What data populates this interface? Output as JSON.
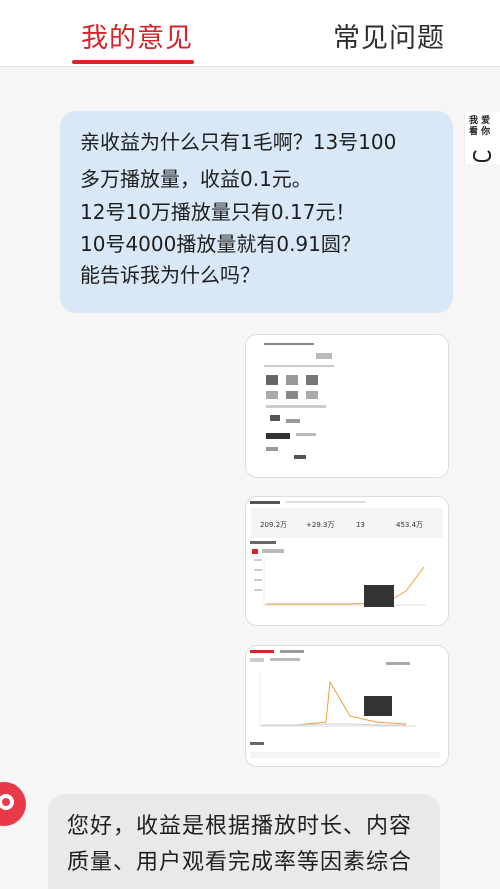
{
  "tabs": {
    "mine": "我的意见",
    "faq": "常见问题"
  },
  "user_avatar": {
    "text": "我 爱 看 你"
  },
  "user_message": {
    "lines": [
      "亲收益为什么只有1毛啊？13号100",
      "多万播放量，收益0.1元。",
      "12号10万播放量只有0.17元！",
      "10号4000播放量就有0.91圆？",
      "能告诉我为什么吗？"
    ]
  },
  "attachments": [
    {
      "icon": "screenshot-thumbnail-icon"
    },
    {
      "icon": "earnings-chart-thumbnail-icon"
    },
    {
      "icon": "playcount-chart-thumbnail-icon"
    }
  ],
  "card2": {
    "stats": [
      "209.2万",
      "+29.3万",
      "13",
      "453.4万"
    ]
  },
  "reply": {
    "lines": [
      "您好，收益是根据播放时长、内容",
      "质量、用户观看完成率等因素综合"
    ]
  },
  "colors": {
    "accent": "#d6242b",
    "user_bubble": "#d9e8f7",
    "reply_bubble": "#e9e9e9"
  }
}
